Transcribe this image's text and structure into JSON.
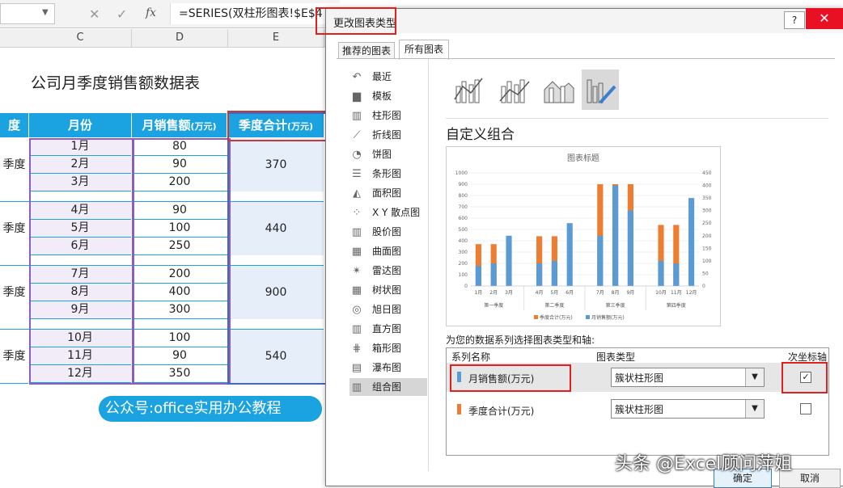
{
  "excel": {
    "formula": "=SERIES(双柱形图表!$E$4",
    "fx_label": "fx",
    "columns": [
      "C",
      "D",
      "E"
    ],
    "sheet_title": "公司月季度销售额数据表",
    "headers": {
      "quarter": "度",
      "month": "月份",
      "sales": "月销售额",
      "sales_unit": "(万元)",
      "total": "季度合计",
      "total_unit": "(万元)"
    },
    "quarters": [
      {
        "label": "季度",
        "total": "370",
        "rows": [
          {
            "month": "1月",
            "sales": "80"
          },
          {
            "month": "2月",
            "sales": "90"
          },
          {
            "month": "3月",
            "sales": "200"
          }
        ]
      },
      {
        "label": "季度",
        "total": "440",
        "rows": [
          {
            "month": "4月",
            "sales": "90"
          },
          {
            "month": "5月",
            "sales": "100"
          },
          {
            "month": "6月",
            "sales": "250"
          }
        ]
      },
      {
        "label": "季度",
        "total": "900",
        "rows": [
          {
            "month": "7月",
            "sales": "200"
          },
          {
            "month": "8月",
            "sales": "400"
          },
          {
            "month": "9月",
            "sales": "300"
          }
        ]
      },
      {
        "label": "季度",
        "total": "540",
        "rows": [
          {
            "month": "10月",
            "sales": "100"
          },
          {
            "month": "11月",
            "sales": "90"
          },
          {
            "month": "12月",
            "sales": "350"
          }
        ]
      }
    ],
    "watermark": "公众号:office实用办公教程"
  },
  "dialog": {
    "title": "更改图表类型",
    "help": "?",
    "close": "✕",
    "tabs": {
      "recommended": "推荐的图表",
      "all": "所有图表"
    },
    "left_items": [
      {
        "label": "最近",
        "icon": "↶"
      },
      {
        "label": "模板",
        "icon": "▆"
      },
      {
        "label": "柱形图",
        "icon": "▥"
      },
      {
        "label": "折线图",
        "icon": "⟋"
      },
      {
        "label": "饼图",
        "icon": "◔"
      },
      {
        "label": "条形图",
        "icon": "☰"
      },
      {
        "label": "面积图",
        "icon": "◭"
      },
      {
        "label": "X Y 散点图",
        "icon": "⁘"
      },
      {
        "label": "股价图",
        "icon": "▥"
      },
      {
        "label": "曲面图",
        "icon": "▦"
      },
      {
        "label": "雷达图",
        "icon": "✴"
      },
      {
        "label": "树状图",
        "icon": "▦"
      },
      {
        "label": "旭日图",
        "icon": "◎"
      },
      {
        "label": "直方图",
        "icon": "▥"
      },
      {
        "label": "箱形图",
        "icon": "⋕"
      },
      {
        "label": "瀑布图",
        "icon": "▤"
      },
      {
        "label": "组合图",
        "icon": "▥"
      }
    ],
    "custom_label": "自定义组合",
    "series_prompt": "为您的数据系列选择图表类型和轴:",
    "col_series": "系列名称",
    "col_type": "图表类型",
    "col_secondary": "次坐标轴",
    "series": [
      {
        "name": "月销售额(万元)",
        "type": "簇状柱形图",
        "secondary": "✓",
        "color": "#5b9bd5"
      },
      {
        "name": "季度合计(万元)",
        "type": "簇状柱形图",
        "secondary": "",
        "color": "#ed7d31"
      }
    ],
    "ok": "确定",
    "cancel": "取消"
  },
  "chart_data": {
    "type": "bar",
    "title": "图表标题",
    "categories": [
      "1月",
      "2月",
      "3月",
      "4月",
      "5月",
      "6月",
      "7月",
      "8月",
      "9月",
      "10月",
      "11月",
      "12月"
    ],
    "groups": [
      "第一季度",
      "第二季度",
      "第三季度",
      "第四季度"
    ],
    "series": [
      {
        "name": "月销售额(万元)",
        "axis": "secondary",
        "values": [
          80,
          90,
          200,
          90,
          100,
          250,
          200,
          400,
          300,
          100,
          90,
          350
        ]
      },
      {
        "name": "季度合计(万元)",
        "axis": "primary",
        "values": [
          370,
          370,
          null,
          440,
          440,
          null,
          900,
          900,
          900,
          540,
          540,
          null
        ]
      }
    ],
    "yticks_left": [
      "1000",
      "900",
      "800",
      "700",
      "600",
      "500",
      "400",
      "300",
      "200",
      "100",
      "0"
    ],
    "yticks_right": [
      "450",
      "400",
      "350",
      "300",
      "250",
      "200",
      "150",
      "100",
      "50",
      "0"
    ],
    "ylim_left": [
      0,
      1000
    ],
    "ylim_right": [
      0,
      450
    ],
    "legend": [
      "季度合计(万元)",
      "月销售额(万元)"
    ],
    "colors": {
      "sales": "#5b9bd5",
      "total": "#ed7d31"
    }
  },
  "caption_watermark": "头条 @Excel顾问萍姐"
}
